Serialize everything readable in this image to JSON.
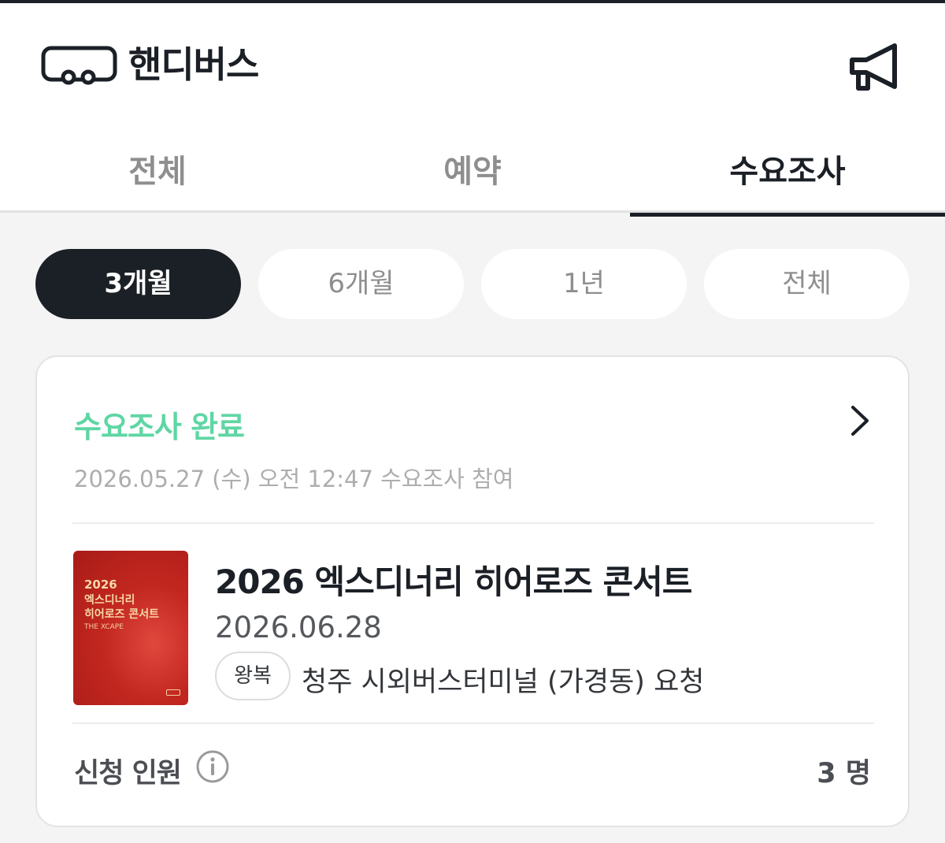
{
  "app": {
    "name": "핸디버스"
  },
  "icons": {
    "logo": "handybus-bus-logo-icon",
    "announcement": "megaphone-icon",
    "detail": "chevron-right-icon",
    "info": "info-circle-icon"
  },
  "tabs": [
    {
      "label": "전체",
      "active": false
    },
    {
      "label": "예약",
      "active": false
    },
    {
      "label": "수요조사",
      "active": true
    }
  ],
  "period_filters": [
    {
      "label": "3개월",
      "active": true
    },
    {
      "label": "6개월",
      "active": false
    },
    {
      "label": "1년",
      "active": false
    },
    {
      "label": "전체",
      "active": false
    }
  ],
  "card": {
    "status": "수요조사 완료",
    "status_color": "#5fd6a4",
    "participation": "2026.05.27 (수) 오전 12:47 수요조사 참여",
    "poster": {
      "year": "2026",
      "line1": "엑스디너리",
      "line2": "히어로즈 콘서트",
      "subtitle": "THE XCAPE"
    },
    "event_title": "2026 엑스디너리 히어로즈 콘서트",
    "event_date": "2026.06.28",
    "trip_type": "왕복",
    "route": "청주 시외버스터미널 (가경동) 요청",
    "applicants_label": "신청 인원",
    "applicants_count": "3 명"
  },
  "colors": {
    "primary_dark": "#1b1f26",
    "accent_green": "#5fd6a4",
    "muted_text": "#8e8e8e"
  }
}
